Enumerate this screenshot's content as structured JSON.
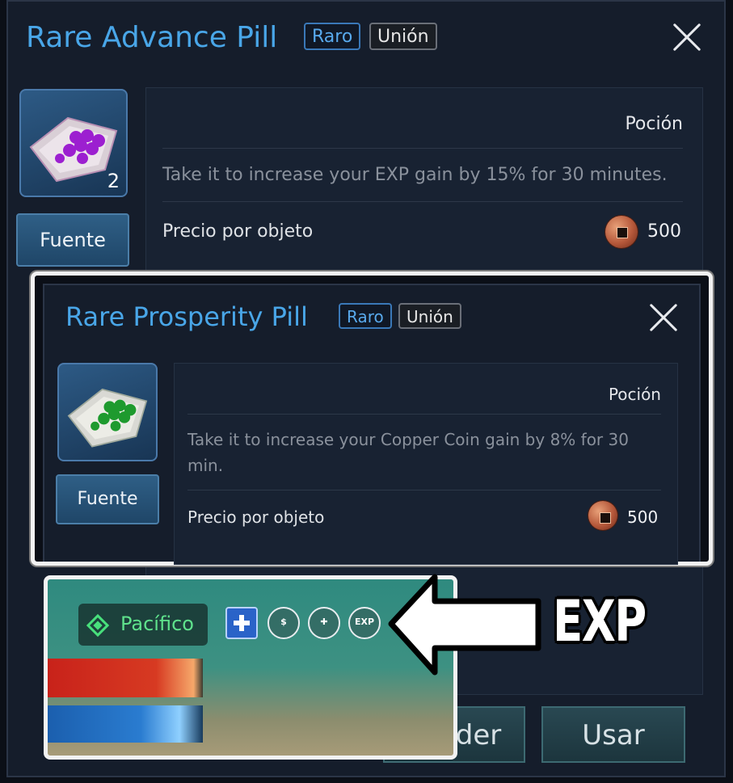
{
  "main_dialog": {
    "title": "Rare Advance Pill",
    "tag_rarity": "Raro",
    "tag_type": "Unión",
    "quantity": "2",
    "source_button": "Fuente",
    "category": "Poción",
    "description": "Take it to increase your EXP gain by 15% for 30 minutes.",
    "price_label": "Precio por objeto",
    "price_value": "500",
    "pill_color": "#9c1fd0"
  },
  "overlay_dialog": {
    "title": "Rare Prosperity Pill",
    "tag_rarity": "Raro",
    "tag_type": "Unión",
    "source_button": "Fuente",
    "category": "Poción",
    "description": "Take it to increase your Copper Coin gain by 8% for 30 min.",
    "price_label": "Precio por objeto",
    "price_value": "500",
    "pill_color": "#1e9a2e"
  },
  "bottom_buttons": {
    "partial_label": "der",
    "use_label": "Usar"
  },
  "game_inset": {
    "status_label": "Pacífico",
    "buff_icons": [
      "add-buff-icon",
      "coin-buff-icon",
      "weapon-buff-icon",
      "exp-buff-icon"
    ],
    "exp_buff_text": "EXP"
  },
  "annotation": {
    "label": "EXP",
    "arrow_icon": "left-arrow-icon"
  }
}
